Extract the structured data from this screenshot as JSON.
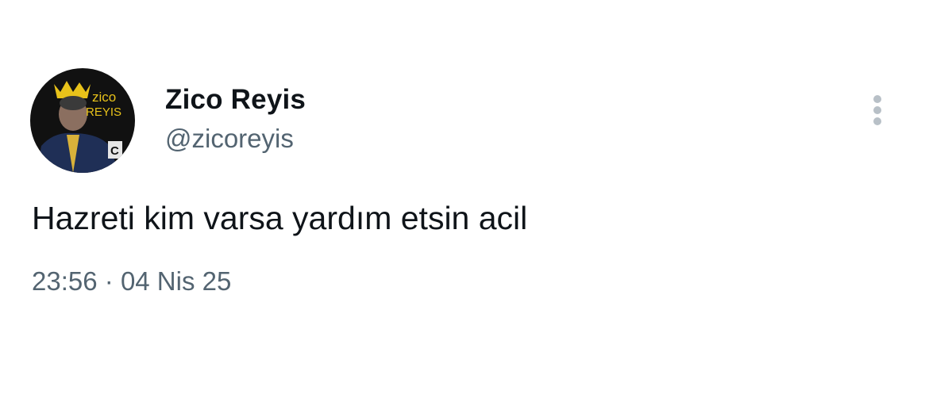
{
  "author": {
    "display_name": "Zico Reyis",
    "handle": "@zicoreyis",
    "avatar": {
      "icon": "profile-photo",
      "overlay_text_line1": "zico",
      "overlay_text_line2": "REYIS",
      "shirt_mark": "C"
    }
  },
  "menu": {
    "icon": "vertical-ellipsis-icon"
  },
  "tweet": {
    "text": "Hazreti kim varsa yardım etsin acil",
    "time": "23:56",
    "separator": "·",
    "date": "04 Nis 25"
  },
  "colors": {
    "primary_text": "#0f1419",
    "secondary_text": "#536471",
    "menu_dots": "#b8c0c7",
    "background": "#ffffff"
  }
}
